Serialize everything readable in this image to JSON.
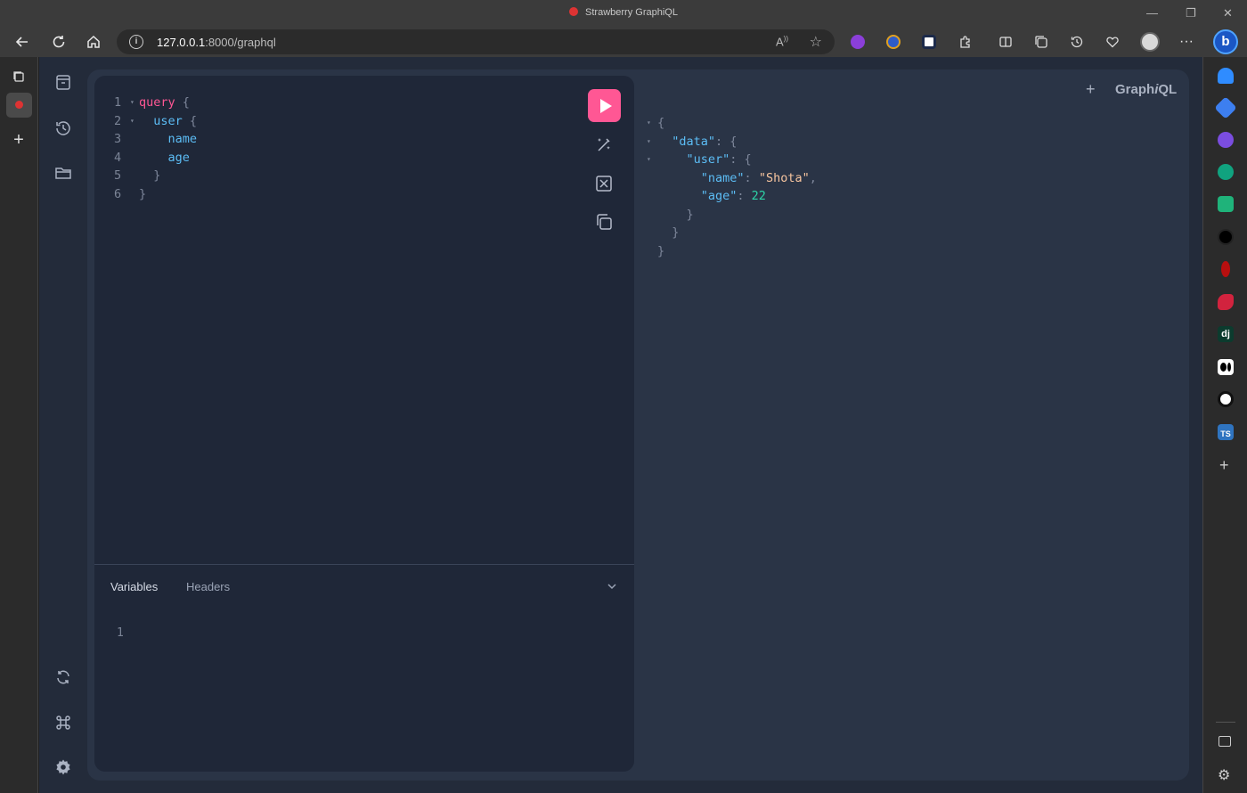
{
  "window": {
    "title": "Strawberry GraphiQL"
  },
  "browser": {
    "address_host": "127.0.0.1",
    "address_rest": ":8000/graphql",
    "read_aloud_label": "A¹¹"
  },
  "editor": {
    "lines": [
      {
        "n": "1",
        "parts": [
          {
            "t": "query",
            "c": "kw"
          },
          {
            "t": " {",
            "c": "punc"
          }
        ]
      },
      {
        "n": "2",
        "parts": [
          {
            "t": "  user",
            "c": "fld"
          },
          {
            "t": " {",
            "c": "punc"
          }
        ]
      },
      {
        "n": "3",
        "parts": [
          {
            "t": "    name",
            "c": "fld"
          }
        ]
      },
      {
        "n": "4",
        "parts": [
          {
            "t": "    age",
            "c": "fld"
          }
        ]
      },
      {
        "n": "5",
        "parts": [
          {
            "t": "  }",
            "c": "punc"
          }
        ]
      },
      {
        "n": "6",
        "parts": [
          {
            "t": "}",
            "c": "punc"
          }
        ]
      }
    ]
  },
  "tabs": {
    "variables": "Variables",
    "headers": "Headers"
  },
  "variables_editor": {
    "line1": "1"
  },
  "brand": {
    "graph": "Graph",
    "i": "i",
    "ql": "QL",
    "plus": "+"
  },
  "response": {
    "name_value": "\"Shota\"",
    "age_value": "22"
  },
  "colors": {
    "accent": "#ff5794",
    "field": "#5cbdf5",
    "string": "#f7c59f",
    "number": "#2dd4a7"
  }
}
